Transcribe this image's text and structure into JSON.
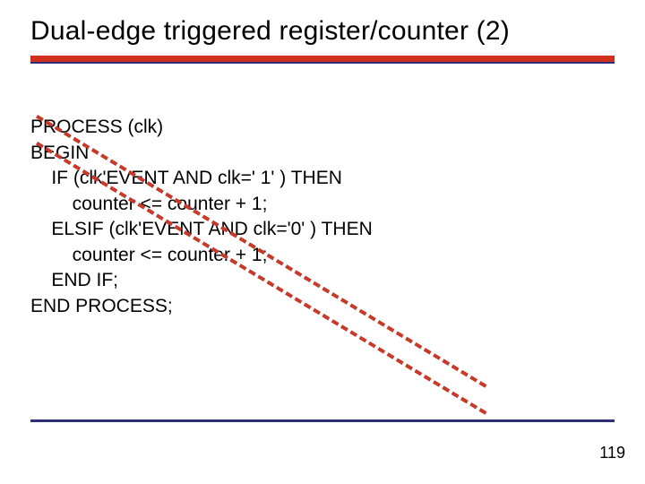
{
  "title": "Dual-edge triggered register/counter (2)",
  "code": {
    "line1": "PROCESS (clk)",
    "line2": "BEGIN",
    "line3": "    IF (clk'EVENT AND clk=' 1' ) THEN",
    "line4": "        counter <= counter + 1;",
    "line5": "    ELSIF (clk'EVENT AND clk='0' ) THEN",
    "line6": "        counter <= counter + 1;",
    "line7": "    END IF;",
    "line8": "END PROCESS;"
  },
  "page_number": "119"
}
